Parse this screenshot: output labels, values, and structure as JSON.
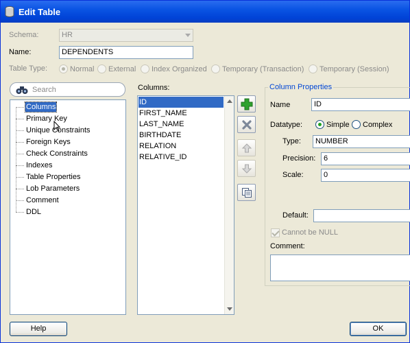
{
  "window": {
    "title": "Edit Table"
  },
  "schema": {
    "label": "Schema:",
    "value": "HR"
  },
  "name": {
    "label": "Name:",
    "value": "DEPENDENTS"
  },
  "table_type": {
    "label": "Table Type:",
    "options": [
      "Normal",
      "External",
      "Index Organized",
      "Temporary (Transaction)",
      "Temporary (Session)"
    ],
    "selected": "Normal"
  },
  "search": {
    "placeholder": "Search"
  },
  "nav": {
    "items": [
      "Columns",
      "Primary Key",
      "Unique Constraints",
      "Foreign Keys",
      "Check Constraints",
      "Indexes",
      "Table Properties",
      "Lob Parameters",
      "Comment",
      "DDL"
    ],
    "selected": "Columns"
  },
  "columns": {
    "label": "Columns:",
    "items": [
      "ID",
      "FIRST_NAME",
      "LAST_NAME",
      "BIRTHDATE",
      "RELATION",
      "RELATIVE_ID"
    ],
    "selected": "ID"
  },
  "toolbar": {
    "add": "add-icon",
    "remove": "remove-icon",
    "up": "move-up-icon",
    "down": "move-down-icon",
    "copy": "copy-icon"
  },
  "column_properties": {
    "title": "Column Properties",
    "name_label": "Name",
    "name_value": "ID",
    "datatype_label": "Datatype:",
    "datatype_options": [
      "Simple",
      "Complex"
    ],
    "datatype_selected": "Simple",
    "type_label": "Type:",
    "type_value": "NUMBER",
    "precision_label": "Precision:",
    "precision_value": "6",
    "scale_label": "Scale:",
    "scale_value": "0",
    "default_label": "Default:",
    "default_value": "",
    "not_null_label": "Cannot be NULL",
    "comment_label": "Comment:",
    "comment_value": ""
  },
  "buttons": {
    "help": "Help",
    "ok": "OK"
  },
  "colors": {
    "title_bar": "#0a54e3",
    "selection": "#316ac5",
    "group_title": "#0046d5",
    "add": "#2ea12e"
  }
}
